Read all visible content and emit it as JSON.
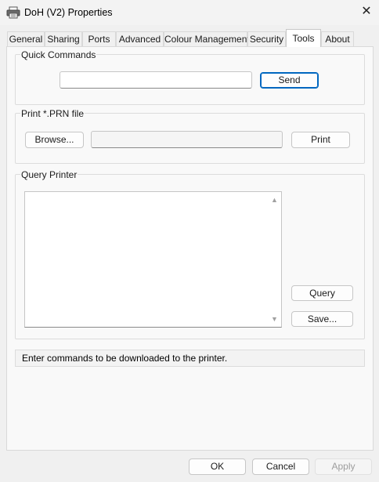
{
  "window": {
    "title": "DoH (V2) Properties",
    "icon": "printer-icon",
    "close": "✕"
  },
  "tabs": [
    {
      "label": "General"
    },
    {
      "label": "Sharing"
    },
    {
      "label": "Ports"
    },
    {
      "label": "Advanced"
    },
    {
      "label": "Colour Management"
    },
    {
      "label": "Security"
    },
    {
      "label": "Tools",
      "active": true
    },
    {
      "label": "About"
    }
  ],
  "quick_commands": {
    "legend": "Quick Commands",
    "input_value": "",
    "send_label": "Send"
  },
  "print_prn": {
    "legend": "Print *.PRN file",
    "browse_label": "Browse...",
    "path_value": "",
    "print_label": "Print"
  },
  "query_printer": {
    "legend": "Query Printer",
    "query_label": "Query",
    "save_label": "Save...",
    "scroll_up": "▲",
    "scroll_down": "▼"
  },
  "status_text": "Enter commands to be downloaded to the printer.",
  "footer": {
    "ok_label": "OK",
    "cancel_label": "Cancel",
    "apply_label": "Apply"
  }
}
